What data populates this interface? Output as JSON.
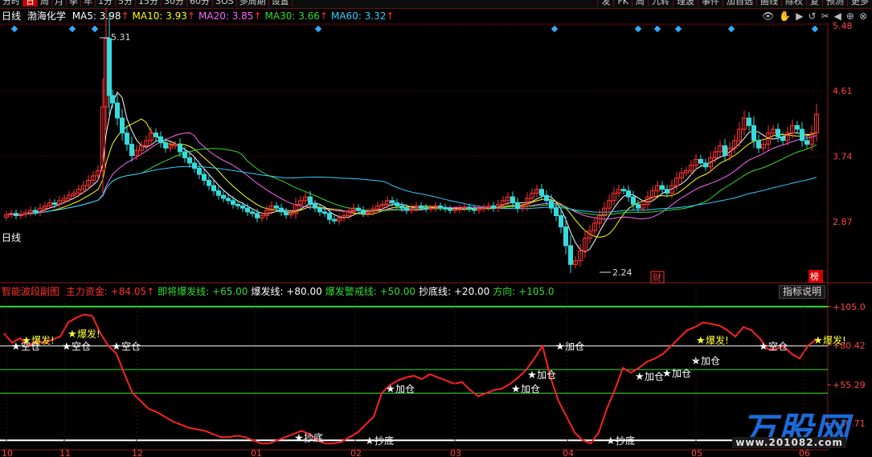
{
  "toolbar": {
    "period_tabs": [
      "分时",
      "日",
      "周",
      "月",
      "季",
      "年",
      "1分",
      "5分",
      "15分",
      "30分",
      "60分",
      "3OS",
      "多周期",
      "设置"
    ],
    "active_tab": "日",
    "right_tools": [
      "发",
      "FK",
      "周",
      "九转",
      "理波",
      "事件",
      "加自选",
      "画线",
      "除权",
      "复",
      "预测",
      "更多"
    ]
  },
  "header": {
    "period": "日线",
    "stock_name": "渤海化学",
    "ma": [
      {
        "label": "MA5:",
        "value": "3.98",
        "arrow": "↑",
        "color": "#ffffff"
      },
      {
        "label": "MA10:",
        "value": "3.93",
        "arrow": "↑",
        "color": "#ffff00"
      },
      {
        "label": "MA20:",
        "value": "3.85",
        "arrow": "↑",
        "color": "#ff66ff"
      },
      {
        "label": "MA30:",
        "value": "3.66",
        "arrow": "↑",
        "color": "#33dd33"
      },
      {
        "label": "MA60:",
        "value": "3.32",
        "arrow": "↑",
        "color": "#33ccff"
      }
    ]
  },
  "price_axis": [
    "5.48",
    "4.61",
    "3.74",
    "2.87"
  ],
  "price_labels": {
    "high": "5.31",
    "low": "2.24",
    "period_mark": "日线",
    "cai": "财",
    "bang": "榜"
  },
  "indicator": {
    "name": "智能波段副图",
    "fields": [
      {
        "label": "主力资金:",
        "value": "+84.05",
        "arrow": "↑",
        "color": "#ff3333"
      },
      {
        "label": "即将爆发线:",
        "value": "+65.00",
        "color": "#33dd33"
      },
      {
        "label": "爆发线:",
        "value": "+80.00",
        "color": "#ffffff"
      },
      {
        "label": "爆发警戒线:",
        "value": "+50.00",
        "color": "#33dd33"
      },
      {
        "label": "抄底线:",
        "value": "+20.00",
        "color": "#ffffff"
      },
      {
        "label": "方向:",
        "value": "+105.0",
        "color": "#33dd33"
      }
    ],
    "help_button": "指标说明",
    "axis": [
      "+105.0",
      "+80.42",
      "+55.29",
      "+30.71"
    ],
    "signals": {
      "burst": "爆发!",
      "empty": "空仓",
      "add": "加仓",
      "bottom": "抄底"
    }
  },
  "months": [
    "10",
    "11",
    "12",
    "01",
    "02",
    "03",
    "04",
    "05",
    "06"
  ],
  "chart_data": {
    "type": "candlestick",
    "ylim": [
      2.1,
      5.5
    ],
    "x": [
      0,
      6,
      12,
      18,
      24,
      30,
      36,
      42,
      48,
      54,
      60,
      66,
      72,
      78,
      84,
      90,
      96,
      102,
      108,
      114,
      120,
      124,
      128,
      132,
      138,
      144,
      150,
      156,
      162,
      168,
      174,
      180,
      186,
      192,
      198,
      204,
      210,
      216,
      222,
      228,
      234,
      240,
      246,
      252,
      258,
      264,
      270,
      276,
      282,
      288,
      294,
      300,
      306,
      312,
      318,
      324,
      330,
      336,
      342,
      348,
      354,
      360,
      366,
      372,
      378,
      384,
      390,
      396,
      402,
      408,
      414,
      420,
      426,
      432,
      438,
      444,
      450,
      456,
      462,
      468,
      474,
      480,
      486,
      492,
      498,
      504,
      510,
      516,
      522,
      528,
      534,
      540,
      546,
      552,
      558,
      564,
      570,
      576,
      582,
      588,
      594,
      600,
      606,
      612,
      618,
      624,
      630,
      636,
      642,
      648,
      654,
      660,
      666,
      672,
      678,
      684,
      690,
      696,
      702,
      708,
      714,
      720,
      726,
      732,
      738,
      744,
      750,
      756,
      762,
      768,
      774,
      780,
      786,
      792,
      798,
      804,
      810,
      816,
      822,
      828,
      834,
      840,
      846,
      852,
      858,
      864,
      870,
      876,
      882,
      888,
      894,
      900,
      906,
      912,
      918,
      924,
      930,
      936,
      942,
      948,
      954,
      960,
      966,
      972,
      978,
      984,
      990,
      996,
      1002,
      1008,
      1014
    ],
    "close": [
      2.96,
      2.98,
      2.95,
      2.97,
      2.99,
      3.02,
      3.0,
      3.05,
      3.08,
      3.12,
      3.1,
      3.15,
      3.18,
      3.22,
      3.25,
      3.3,
      3.35,
      3.42,
      3.48,
      3.55,
      4.4,
      5.31,
      4.55,
      4.45,
      4.25,
      4.05,
      3.9,
      3.75,
      3.82,
      3.88,
      3.95,
      4.05,
      4.0,
      3.92,
      3.85,
      3.88,
      3.9,
      3.8,
      3.72,
      3.65,
      3.58,
      3.5,
      3.42,
      3.35,
      3.28,
      3.22,
      3.18,
      3.15,
      3.1,
      3.08,
      3.05,
      3.0,
      2.98,
      2.92,
      2.95,
      3.02,
      3.08,
      3.05,
      3.0,
      2.96,
      2.98,
      3.1,
      3.15,
      3.2,
      3.1,
      3.05,
      3.0,
      2.98,
      2.9,
      2.88,
      2.92,
      2.95,
      3.0,
      3.05,
      3.02,
      2.98,
      3.0,
      3.04,
      3.08,
      3.1,
      3.15,
      3.12,
      3.08,
      3.05,
      3.02,
      3.05,
      3.08,
      3.06,
      3.04,
      3.05,
      3.08,
      3.06,
      3.04,
      3.02,
      3.03,
      3.05,
      3.06,
      3.04,
      3.02,
      3.04,
      3.06,
      3.08,
      3.05,
      3.1,
      3.15,
      3.2,
      3.12,
      3.05,
      3.08,
      3.18,
      3.25,
      3.3,
      3.22,
      3.15,
      3.05,
      2.95,
      2.8,
      2.55,
      2.3,
      2.35,
      2.48,
      2.65,
      2.75,
      2.85,
      2.95,
      3.05,
      3.15,
      3.25,
      3.3,
      3.28,
      3.2,
      3.1,
      3.05,
      3.1,
      3.2,
      3.28,
      3.35,
      3.3,
      3.25,
      3.35,
      3.45,
      3.52,
      3.55,
      3.62,
      3.7,
      3.65,
      3.6,
      3.72,
      3.8,
      3.88,
      3.75,
      3.85,
      3.95,
      4.1,
      4.25,
      4.15,
      3.95,
      3.85,
      3.9,
      4.05,
      4.1,
      4.0,
      3.95,
      4.05,
      4.15,
      4.1,
      3.95,
      3.9,
      4.05,
      4.3
    ]
  },
  "indicator_data": {
    "ylim": [
      15,
      110
    ],
    "burst_line": 80,
    "warn_line": 50,
    "near_line": 65,
    "bottom_line": 20,
    "direction_line": 105,
    "x": [
      0,
      10,
      20,
      30,
      40,
      50,
      60,
      70,
      80,
      90,
      100,
      110,
      120,
      130,
      140,
      150,
      160,
      170,
      180,
      190,
      200,
      210,
      220,
      230,
      240,
      250,
      260,
      270,
      280,
      290,
      300,
      310,
      320,
      330,
      340,
      350,
      360,
      370,
      380,
      390,
      400,
      410,
      420,
      430,
      440,
      450,
      460,
      470,
      480,
      490,
      500,
      510,
      520,
      530,
      540,
      550,
      560,
      570,
      580,
      590,
      600,
      610,
      620,
      630,
      640,
      650,
      660,
      670,
      680,
      690,
      700,
      710,
      720,
      730,
      740,
      750,
      760,
      770,
      780,
      790,
      800,
      810,
      820,
      830,
      840,
      850,
      860,
      870,
      880,
      890,
      900,
      910,
      920,
      930,
      940,
      950,
      960,
      970,
      980,
      990,
      1000,
      1010
    ],
    "main_fund": [
      88,
      82,
      85,
      80,
      83,
      82,
      84,
      86,
      95,
      98,
      100,
      99,
      88,
      80,
      75,
      62,
      50,
      45,
      40,
      38,
      35,
      32,
      30,
      28,
      27,
      26,
      24,
      22,
      22,
      23,
      22,
      20,
      18,
      18,
      20,
      22,
      24,
      26,
      24,
      20,
      18,
      18,
      19,
      22,
      25,
      30,
      35,
      50,
      55,
      58,
      60,
      61,
      59,
      62,
      60,
      58,
      56,
      57,
      52,
      48,
      50,
      52,
      53,
      56,
      60,
      65,
      72,
      80,
      60,
      45,
      35,
      25,
      20,
      18,
      25,
      40,
      52,
      66,
      63,
      66,
      70,
      72,
      75,
      80,
      85,
      90,
      92,
      95,
      94,
      93,
      90,
      86,
      92,
      90,
      85,
      78,
      78,
      80,
      75,
      72,
      80,
      84
    ]
  },
  "signal_points": [
    {
      "type": "burst",
      "x": 33,
      "v": 84
    },
    {
      "type": "empty",
      "x": 20,
      "v": 80
    },
    {
      "type": "burst",
      "x": 90,
      "v": 88
    },
    {
      "type": "empty",
      "x": 83,
      "v": 80
    },
    {
      "type": "empty",
      "x": 145,
      "v": 80
    },
    {
      "type": "add",
      "x": 486,
      "v": 53
    },
    {
      "type": "bottom",
      "x": 372,
      "v": 22
    },
    {
      "type": "bottom",
      "x": 460,
      "v": 20
    },
    {
      "type": "add",
      "x": 642,
      "v": 53
    },
    {
      "type": "add",
      "x": 662,
      "v": 62
    },
    {
      "type": "add",
      "x": 697,
      "v": 80
    },
    {
      "type": "bottom",
      "x": 760,
      "v": 20
    },
    {
      "type": "add",
      "x": 796,
      "v": 61
    },
    {
      "type": "add",
      "x": 830,
      "v": 63
    },
    {
      "type": "add",
      "x": 866,
      "v": 71
    },
    {
      "type": "burst",
      "x": 872,
      "v": 84
    },
    {
      "type": "empty",
      "x": 950,
      "v": 80
    },
    {
      "type": "burst",
      "x": 1018,
      "v": 84
    }
  ],
  "watermark": {
    "brand": "万股网",
    "url": "www.201082.com"
  }
}
